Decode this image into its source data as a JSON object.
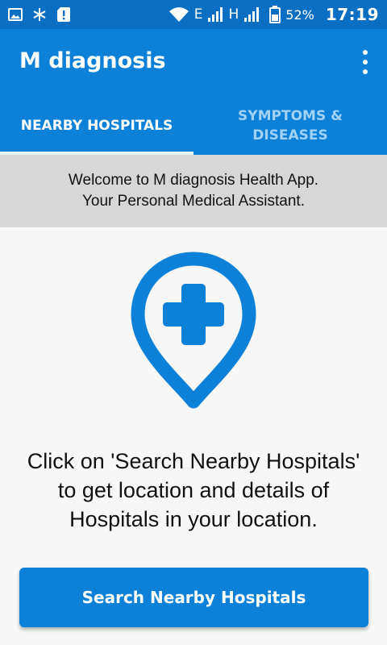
{
  "status_bar": {
    "net_e": "E",
    "net_h": "H",
    "battery_pct": "52%",
    "time": "17:19",
    "icons": [
      "image-icon",
      "snowflake-icon",
      "sim-alert-icon",
      "wifi-icon",
      "signal-icon",
      "signal-icon",
      "battery-icon"
    ]
  },
  "app_bar": {
    "title": "M diagnosis",
    "menu_icon": "overflow-menu-icon"
  },
  "tabs": [
    {
      "label": "NEARBY HOSPITALS",
      "active": true
    },
    {
      "label": "SYMPTOMS & DISEASES",
      "active": false
    }
  ],
  "welcome": {
    "line1": "Welcome to M diagnosis Health App.",
    "line2": "Your Personal Medical Assistant."
  },
  "main": {
    "icon": "hospital-location-icon",
    "instruction": "Click on 'Search Nearby Hospitals' to get location and details of Hospitals in your location.",
    "search_button_label": "Search Nearby Hospitals"
  },
  "colors": {
    "status_bar": "#0a6fc2",
    "primary": "#0d80d8",
    "tab_inactive": "#9fd2f7",
    "banner": "#d7d7d7"
  }
}
